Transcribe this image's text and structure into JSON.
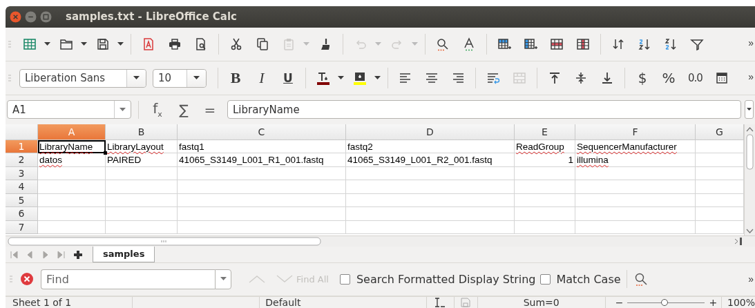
{
  "window": {
    "title": "samples.txt - LibreOffice Calc"
  },
  "standard_toolbar": {
    "buttons": [
      {
        "disabled": false
      },
      {
        "disabled": false
      },
      {
        "disabled": false
      },
      {
        "disabled": false
      },
      {
        "disabled": false
      },
      {
        "disabled": false
      },
      {
        "disabled": false
      },
      {
        "disabled": false
      },
      {
        "disabled": true
      },
      {
        "disabled": false
      },
      {
        "disabled": true
      },
      {
        "disabled": true
      },
      {
        "disabled": false
      },
      {
        "disabled": false
      },
      {
        "disabled": false
      },
      {
        "disabled": false
      },
      {
        "disabled": false
      },
      {
        "disabled": false
      },
      {
        "disabled": false
      },
      {
        "disabled": false
      },
      {
        "disabled": false
      },
      {
        "disabled": false
      }
    ],
    "overflow": "»"
  },
  "formatting_toolbar": {
    "font_name": {
      "value": "Liberation Sans"
    },
    "font_size": {
      "value": "10"
    },
    "buttons": [
      {
        "text": "B",
        "disabled": false
      },
      {
        "text": "I",
        "disabled": false
      },
      {
        "text": "U",
        "disabled": false
      },
      {
        "disabled": false
      },
      {
        "disabled": false
      },
      {
        "disabled": false
      },
      {
        "disabled": false
      },
      {
        "disabled": false
      },
      {
        "disabled": false
      },
      {
        "disabled": true
      },
      {
        "disabled": false
      },
      {
        "disabled": false
      },
      {
        "disabled": false
      },
      {
        "text": "$",
        "disabled": false
      },
      {
        "text": "%",
        "disabled": false
      },
      {
        "text": "0.0",
        "disabled": false
      },
      {
        "disabled": false
      }
    ],
    "overflow": "»"
  },
  "formula_bar": {
    "name_box": {
      "value": "A1"
    },
    "buttons": [
      {
        "text": "f$_{x}$"
      },
      {
        "text": "∑"
      },
      {
        "text": "="
      }
    ],
    "input": {
      "value": "LibraryName"
    }
  },
  "sheet": {
    "columns": [
      {
        "label": "A",
        "selected": true
      },
      {
        "label": "B",
        "selected": false
      },
      {
        "label": "C",
        "selected": false
      },
      {
        "label": "D",
        "selected": false
      },
      {
        "label": "E",
        "selected": false
      },
      {
        "label": "F",
        "selected": false
      },
      {
        "label": "G",
        "selected": false
      }
    ],
    "rows": [
      {
        "label": "1",
        "selected": true,
        "cells": [
          {
            "text": "LibraryName",
            "misspelled": true,
            "active": true
          },
          {
            "text": "LibraryLayout",
            "misspelled": true,
            "active": false
          },
          {
            "text": "fastq1",
            "misspelled": false,
            "active": false
          },
          {
            "text": "fastq2",
            "misspelled": false,
            "active": false
          },
          {
            "text": "ReadGroup",
            "misspelled": true,
            "active": false
          },
          {
            "text": "SequencerManufacturer",
            "misspelled": true,
            "active": false
          }
        ]
      },
      {
        "label": "2",
        "selected": false,
        "cells": [
          {
            "text": "datos",
            "misspelled": true,
            "active": false
          },
          {
            "text": "PAIRED",
            "misspelled": false,
            "active": false
          },
          {
            "text": "41065_S3149_L001_R1_001.fastq",
            "misspelled": false,
            "active": false
          },
          {
            "text": "41065_S3149_L001_R2_001.fastq",
            "misspelled": false,
            "active": false
          },
          {
            "text": "1",
            "kind": "number",
            "misspelled": false,
            "active": false
          },
          {
            "text": "illumina",
            "misspelled": true,
            "active": false
          }
        ]
      },
      {
        "label": "3",
        "selected": false,
        "cells": []
      },
      {
        "label": "4",
        "selected": false,
        "cells": []
      },
      {
        "label": "5",
        "selected": false,
        "cells": []
      },
      {
        "label": "6",
        "selected": false,
        "cells": []
      },
      {
        "label": "7",
        "selected": false,
        "cells": []
      }
    ]
  },
  "sheet_tabs": {
    "tabs": [
      {
        "label": "samples",
        "selected": true
      }
    ]
  },
  "find_bar": {
    "search": {
      "placeholder": "Find"
    },
    "find_all": {
      "label": "Find All",
      "disabled": true
    },
    "options": [
      {
        "label": "Search Formatted Display String",
        "checked": false
      },
      {
        "label": "Match Case",
        "checked": false
      }
    ],
    "overflow": "»"
  },
  "status_bar": {
    "sheet": "Sheet 1 of 1",
    "page_style": "Default",
    "sum": "Sum=0",
    "zoom_out": "−",
    "zoom_in": "+",
    "zoom": {
      "level": 0.48
    },
    "zoom_percent": "100%"
  }
}
